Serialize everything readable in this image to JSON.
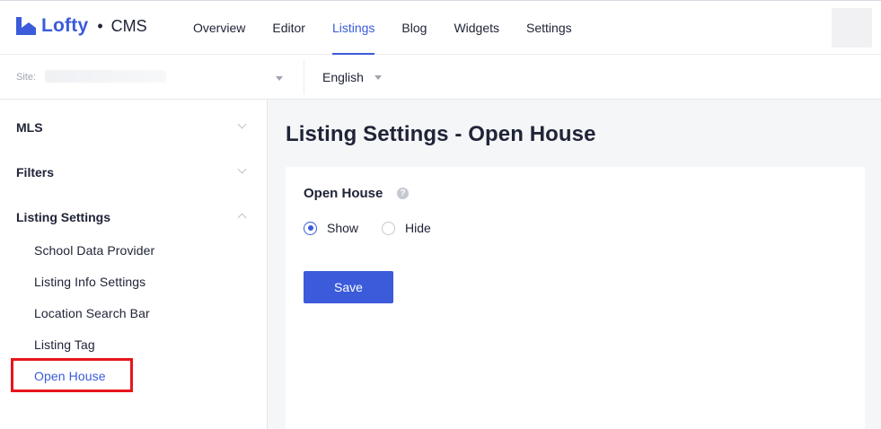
{
  "app": {
    "logo_text": "Lofty",
    "separator": "•",
    "product": "CMS"
  },
  "nav": {
    "items": [
      {
        "label": "Overview",
        "active": false
      },
      {
        "label": "Editor",
        "active": false
      },
      {
        "label": "Listings",
        "active": true
      },
      {
        "label": "Blog",
        "active": false
      },
      {
        "label": "Widgets",
        "active": false
      },
      {
        "label": "Settings",
        "active": false
      }
    ]
  },
  "subbar": {
    "site_label": "Site:",
    "language": "English"
  },
  "sidebar": {
    "groups": [
      {
        "label": "MLS",
        "expanded": false
      },
      {
        "label": "Filters",
        "expanded": false
      },
      {
        "label": "Listing Settings",
        "expanded": true
      }
    ],
    "items": [
      {
        "label": "School Data Provider",
        "active": false
      },
      {
        "label": "Listing Info Settings",
        "active": false
      },
      {
        "label": "Location Search Bar",
        "active": false
      },
      {
        "label": "Listing Tag",
        "active": false
      },
      {
        "label": "Open House",
        "active": true
      }
    ]
  },
  "main": {
    "title": "Listing Settings - Open House",
    "field_label": "Open House",
    "help_glyph": "?",
    "options": [
      {
        "label": "Show",
        "checked": true
      },
      {
        "label": "Hide",
        "checked": false
      }
    ],
    "save_label": "Save"
  },
  "colors": {
    "accent": "#3b5bdb",
    "highlight": "#e8141c",
    "text": "#202437"
  }
}
